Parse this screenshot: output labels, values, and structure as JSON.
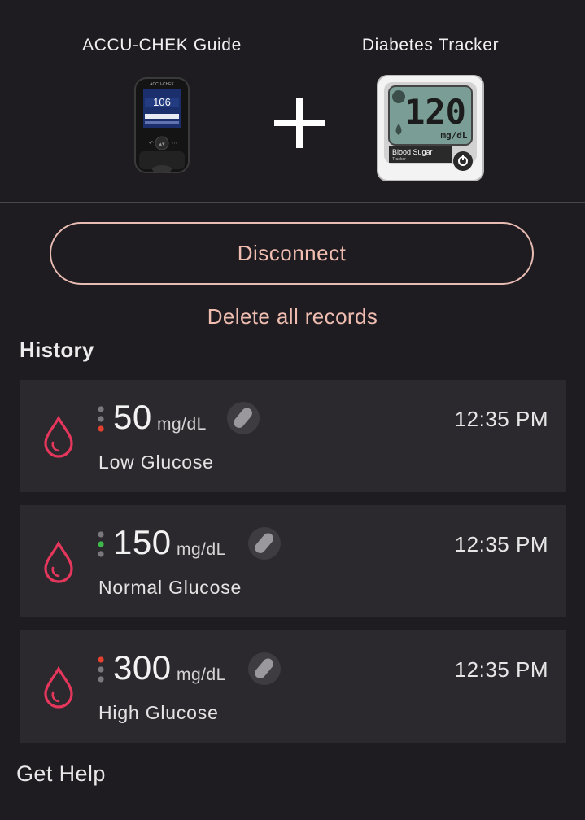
{
  "devices": {
    "left_title": "ACCU-CHEK Guide",
    "right_title": "Diabetes Tracker",
    "meter_reading": "106",
    "tracker_reading": "120",
    "tracker_unit": "mg/dL",
    "tracker_caption": "Blood Sugar",
    "tracker_caption_sub": "Tracker"
  },
  "actions": {
    "disconnect_label": "Disconnect",
    "delete_label": "Delete all records"
  },
  "history": {
    "title": "History",
    "records": [
      {
        "value": "50",
        "unit": "mg/dL",
        "status": "Low Glucose",
        "time": "12:35 PM",
        "level": "low"
      },
      {
        "value": "150",
        "unit": "mg/dL",
        "status": "Normal Glucose",
        "time": "12:35 PM",
        "level": "normal"
      },
      {
        "value": "300",
        "unit": "mg/dL",
        "status": "High Glucose",
        "time": "12:35 PM",
        "level": "high"
      }
    ]
  },
  "footer": {
    "help_label": "Get Help"
  },
  "colors": {
    "accent": "#efbcb0",
    "drop": "#e5365c",
    "low": "#e5412f",
    "normal": "#3db84a",
    "high": "#e5412f",
    "inactive_dot": "#7a787c"
  }
}
